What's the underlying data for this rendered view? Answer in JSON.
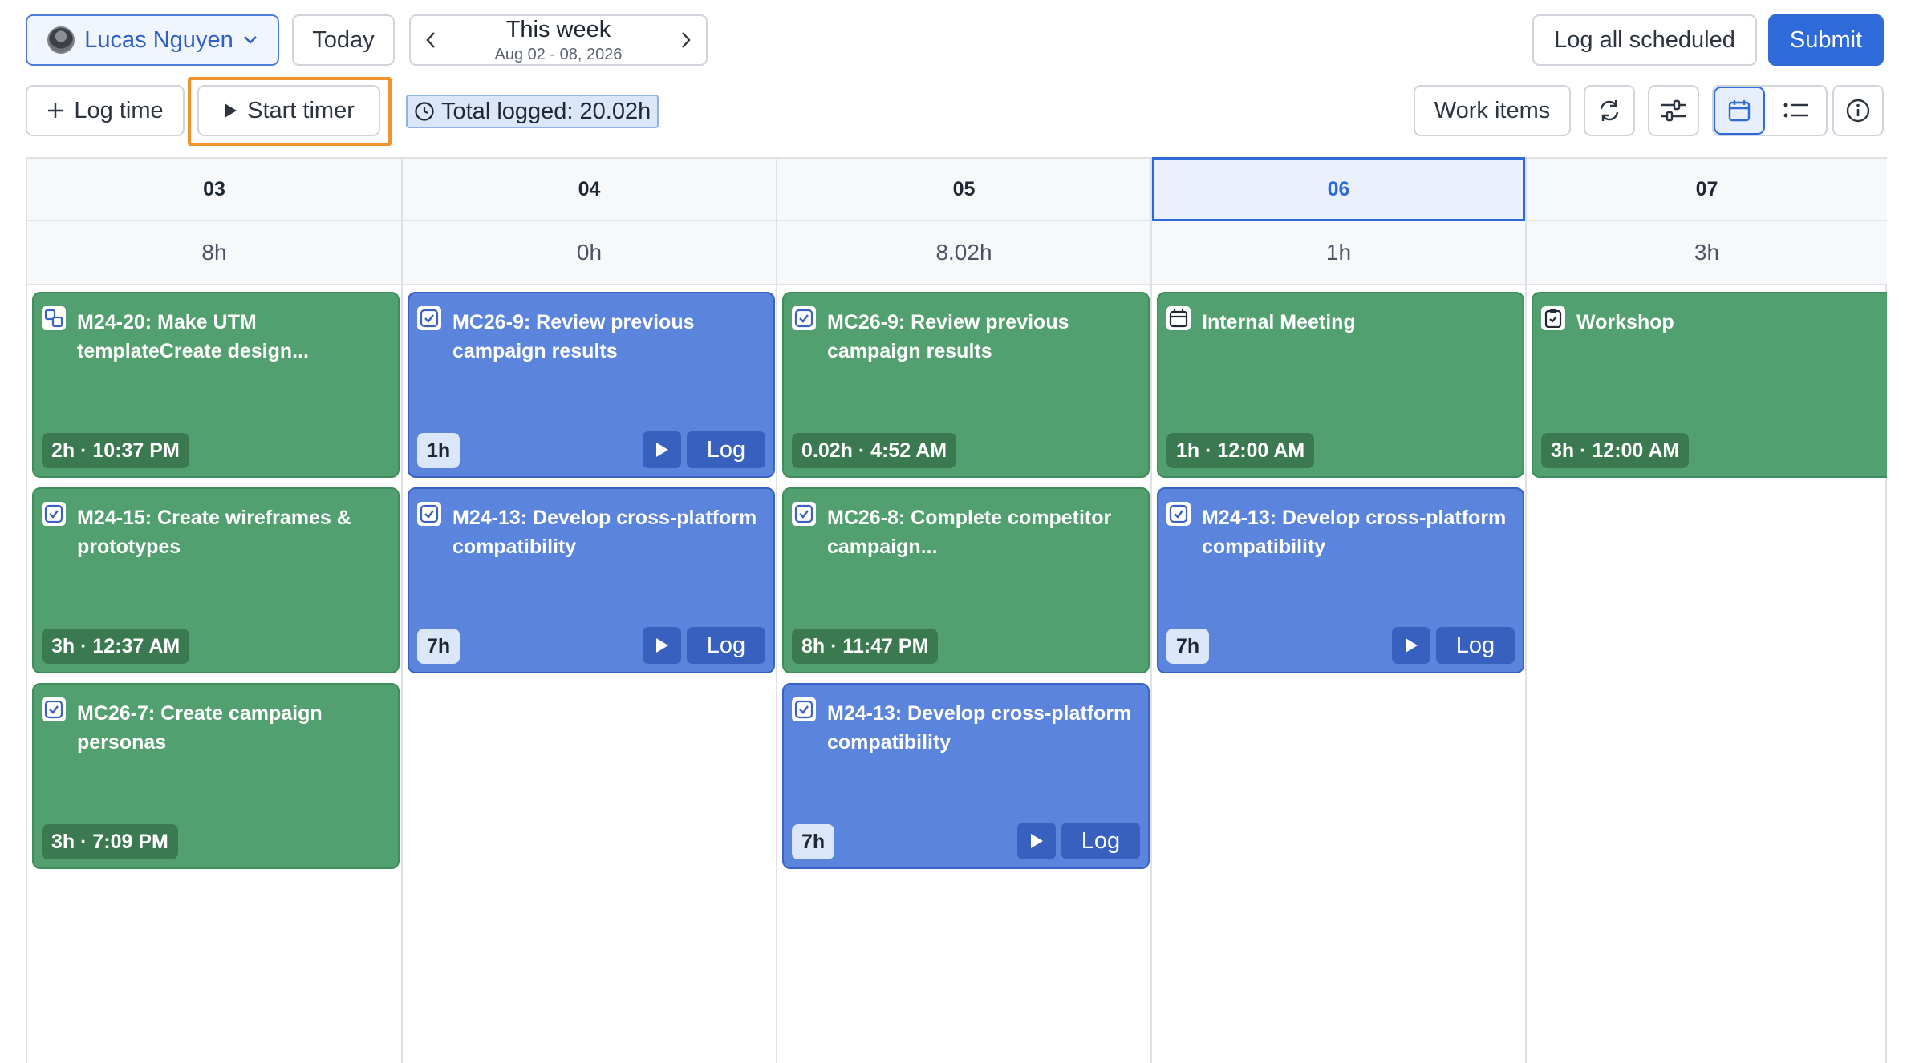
{
  "header": {
    "user_name": "Lucas Nguyen",
    "today_label": "Today",
    "week_title": "This week",
    "week_range": "Aug 02 - 08, 2026",
    "log_all_label": "Log all scheduled",
    "submit_label": "Submit"
  },
  "toolbar": {
    "log_time_label": "Log time",
    "start_timer_label": "Start timer",
    "total_logged": "Total logged: 20.02h",
    "work_items_label": "Work items"
  },
  "days": [
    {
      "label": "03",
      "total": "8h",
      "active": false
    },
    {
      "label": "04",
      "total": "0h",
      "active": false
    },
    {
      "label": "05",
      "total": "8.02h",
      "active": false
    },
    {
      "label": "06",
      "total": "1h",
      "active": true
    },
    {
      "label": "07",
      "total": "3h",
      "active": false
    }
  ],
  "entries": {
    "d03_1": {
      "title": "M24-20: Make UTM templateCreate design...",
      "meta": "2h · 10:37 PM",
      "icon": "subtask-icon"
    },
    "d03_2": {
      "title": "M24-15: Create wireframes & prototypes",
      "meta": "3h · 12:37 AM",
      "icon": "checkbox-icon"
    },
    "d03_3": {
      "title": "MC26-7: Create campaign personas",
      "meta": "3h · 7:09 PM",
      "icon": "checkbox-icon"
    },
    "d04_1": {
      "title": "MC26-9: Review previous campaign results",
      "meta": "1h",
      "log": "Log",
      "icon": "checkbox-icon"
    },
    "d04_2": {
      "title": "M24-13: Develop cross-platform compatibility",
      "meta": "7h",
      "log": "Log",
      "icon": "checkbox-icon"
    },
    "d05_1": {
      "title": "MC26-9: Review previous campaign results",
      "meta": "0.02h · 4:52 AM",
      "icon": "checkbox-icon"
    },
    "d05_2": {
      "title": "MC26-8: Complete competitor campaign...",
      "meta": "8h · 11:47 PM",
      "icon": "checkbox-icon"
    },
    "d05_3": {
      "title": "M24-13: Develop cross-platform compatibility",
      "meta": "7h",
      "log": "Log",
      "icon": "checkbox-icon"
    },
    "d06_1": {
      "title": "Internal Meeting",
      "meta": "1h · 12:00 AM",
      "icon": "calendar-icon"
    },
    "d06_2": {
      "title": "M24-13: Develop cross-platform compatibility",
      "meta": "7h",
      "log": "Log",
      "icon": "checkbox-icon"
    },
    "d07_1": {
      "title": "Workshop",
      "meta": "3h · 12:00 AM",
      "icon": "clipboard-icon"
    }
  },
  "colors": {
    "logged": "#52a06f",
    "scheduled": "#5b84dd",
    "accent": "#2e6bd8",
    "highlight": "#f0922e"
  }
}
